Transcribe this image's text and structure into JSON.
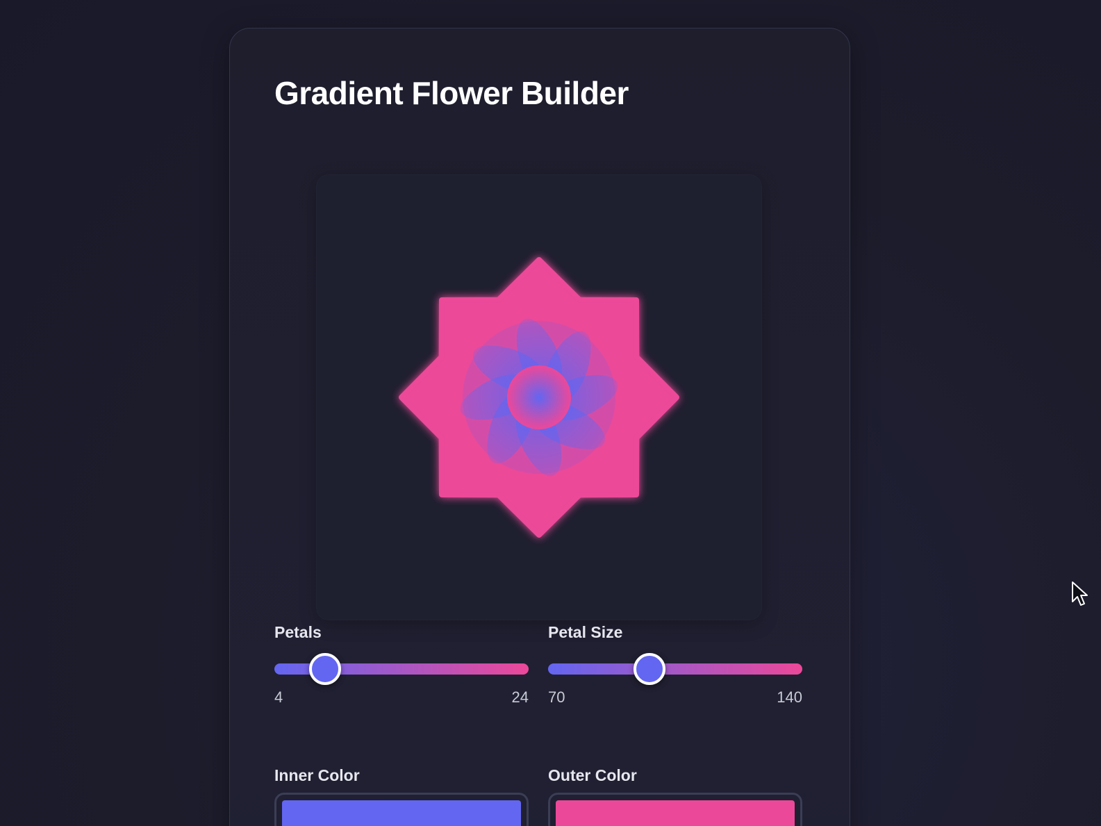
{
  "app": {
    "title": "Gradient Flower Builder"
  },
  "flower": {
    "petals": 8,
    "inner_color": "#6366f1",
    "outer_color": "#ec4899"
  },
  "controls": {
    "petals": {
      "label": "Petals",
      "min": "4",
      "max": "24",
      "value": 8
    },
    "petal_size": {
      "label": "Petal Size",
      "min": "70",
      "max": "140",
      "value": 98
    },
    "inner_color": {
      "label": "Inner Color",
      "value": "#6366f1"
    },
    "outer_color": {
      "label": "Outer Color",
      "value": "#ec4899"
    }
  },
  "icons": {
    "cursor": "mouse-pointer-icon"
  }
}
